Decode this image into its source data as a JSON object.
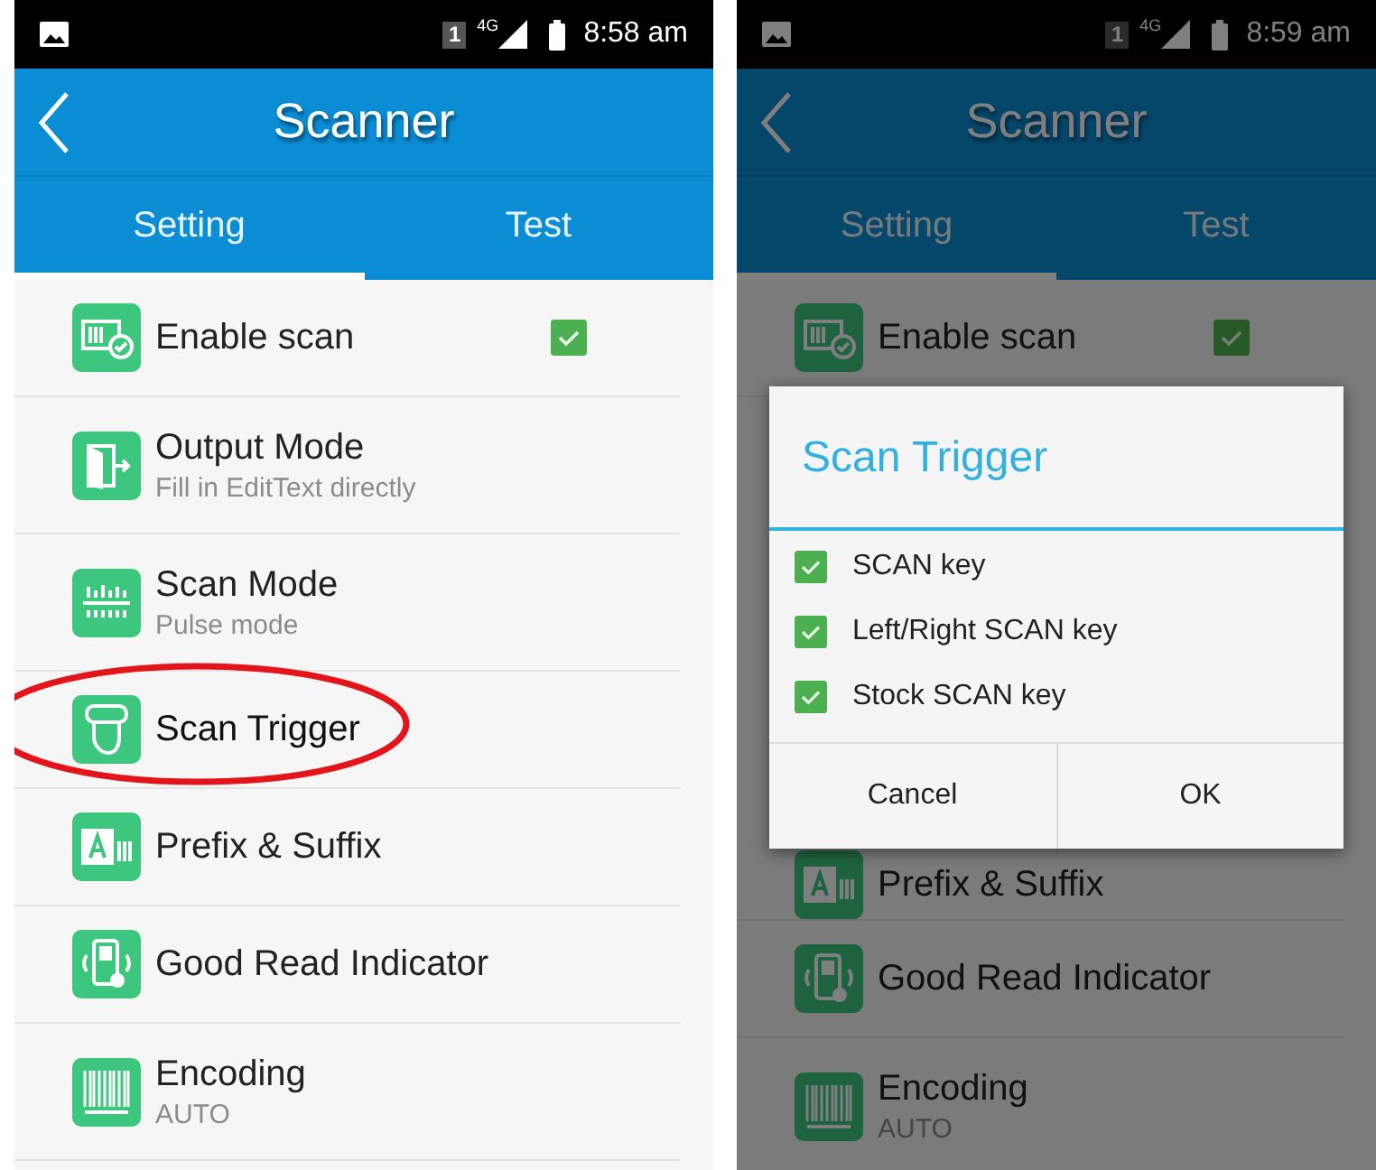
{
  "screens": [
    {
      "status_bar": {
        "sim": "1",
        "network": "4G",
        "time": "8:58 am"
      },
      "app_bar": {
        "title": "Scanner"
      },
      "tabs": [
        {
          "label": "Setting",
          "selected": true
        },
        {
          "label": "Test",
          "selected": false
        }
      ],
      "settings": [
        {
          "kind": "enable",
          "title": "Enable scan",
          "checked": true,
          "highlighted": false
        },
        {
          "kind": "output",
          "title": "Output Mode",
          "subtitle": "Fill in EditText directly",
          "highlighted": false
        },
        {
          "kind": "mode",
          "title": "Scan Mode",
          "subtitle": "Pulse mode",
          "highlighted": false
        },
        {
          "kind": "trigger",
          "title": "Scan Trigger",
          "highlighted": true
        },
        {
          "kind": "affix",
          "title": "Prefix & Suffix",
          "highlighted": false
        },
        {
          "kind": "indicator",
          "title": "Good Read Indicator",
          "highlighted": false
        },
        {
          "kind": "encoding",
          "title": "Encoding",
          "subtitle": "AUTO",
          "highlighted": false
        }
      ]
    },
    {
      "status_bar": {
        "sim": "1",
        "network": "4G",
        "time": "8:59 am"
      },
      "app_bar": {
        "title": "Scanner"
      },
      "tabs": [
        {
          "label": "Setting",
          "selected": true
        },
        {
          "label": "Test",
          "selected": false
        }
      ],
      "settings": [
        {
          "kind": "enable",
          "title": "Enable scan",
          "checked": true,
          "highlighted": false
        },
        {
          "kind": "affix",
          "title": "Prefix & Suffix",
          "highlighted": false
        },
        {
          "kind": "indicator",
          "title": "Good Read Indicator",
          "highlighted": false
        },
        {
          "kind": "encoding",
          "title": "Encoding",
          "subtitle": "AUTO",
          "highlighted": false
        }
      ],
      "dialog": {
        "title": "Scan Trigger",
        "options": [
          {
            "label": "SCAN key",
            "checked": true
          },
          {
            "label": "Left/Right SCAN key",
            "checked": true
          },
          {
            "label": "Stock SCAN key",
            "checked": true
          }
        ],
        "buttons": [
          "Cancel",
          "OK"
        ]
      }
    }
  ]
}
